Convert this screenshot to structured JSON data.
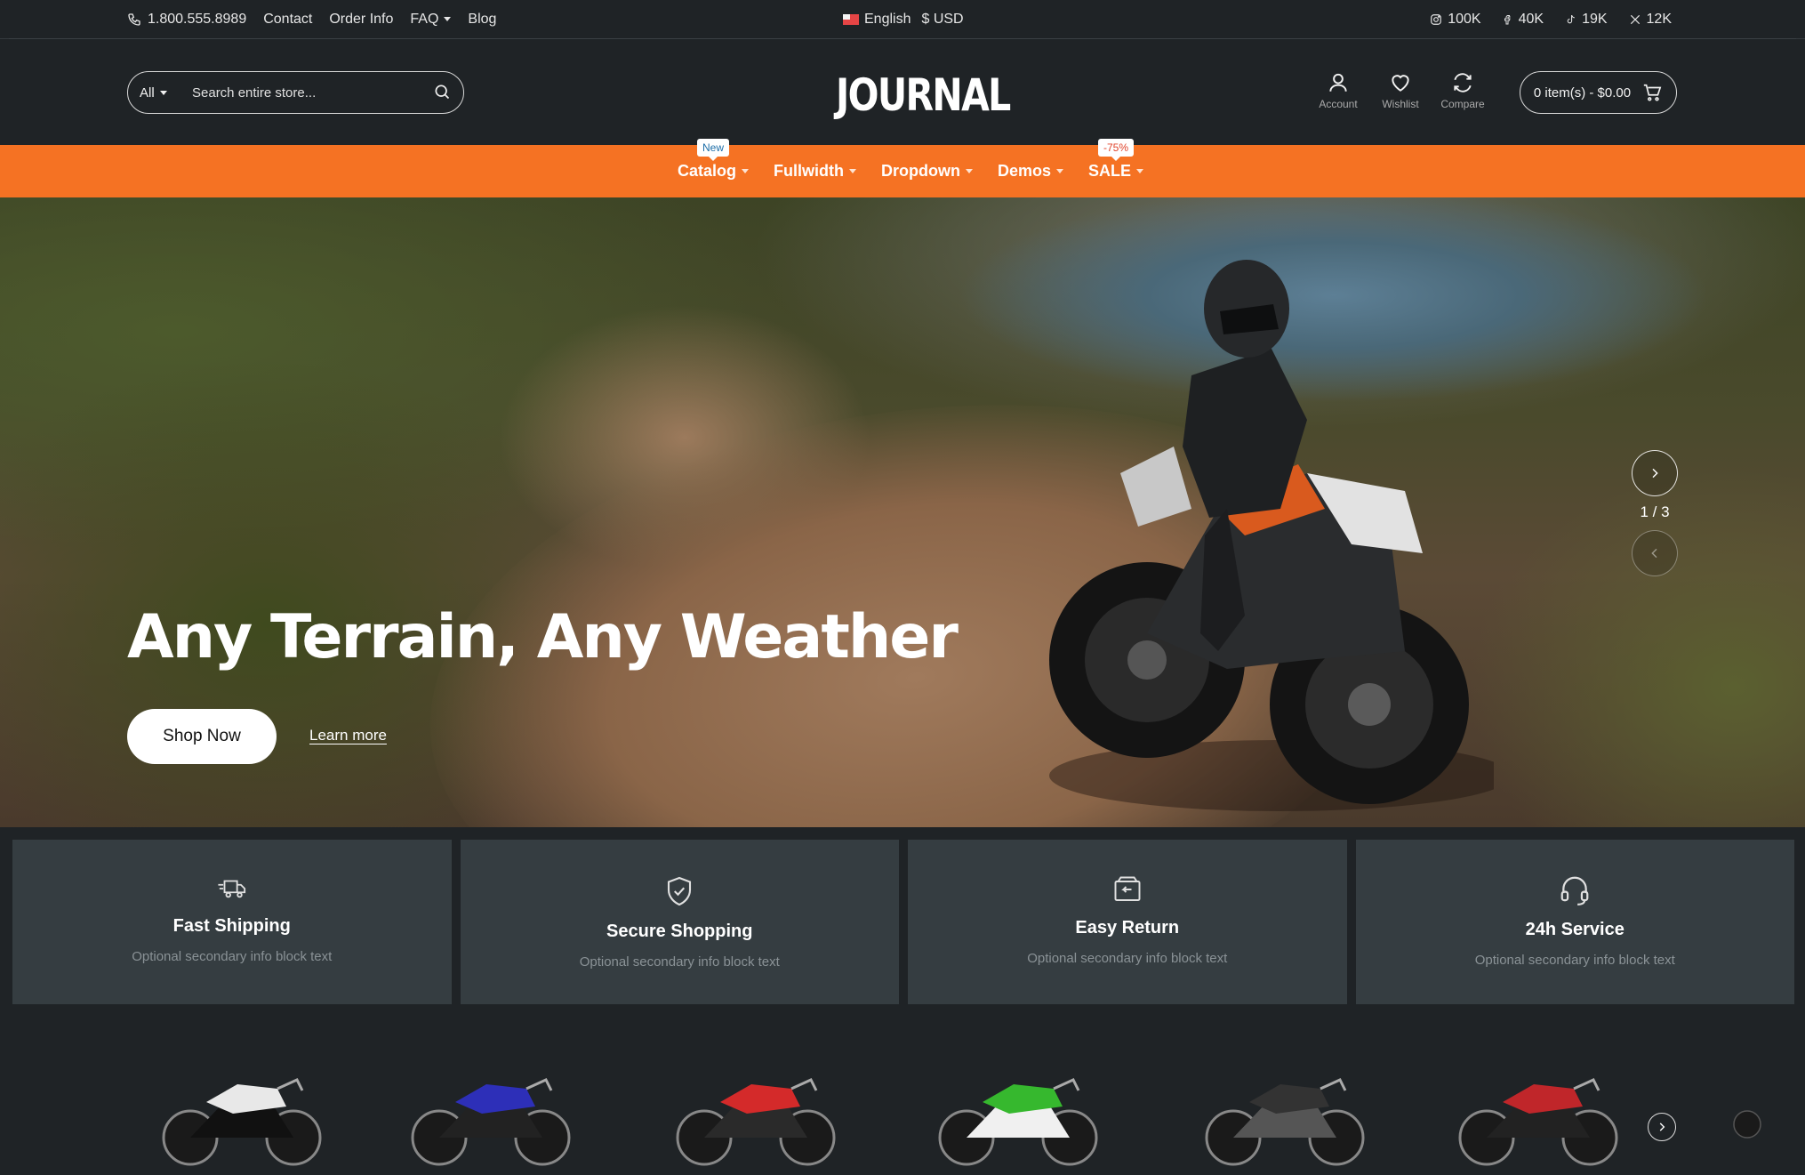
{
  "topbar": {
    "phone": "1.800.555.8989",
    "links": [
      "Contact",
      "Order Info",
      "FAQ",
      "Blog"
    ],
    "language": "English",
    "currency": "$ USD",
    "social": [
      {
        "icon": "instagram-icon",
        "count": "100K"
      },
      {
        "icon": "facebook-icon",
        "count": "40K"
      },
      {
        "icon": "tiktok-icon",
        "count": "19K"
      },
      {
        "icon": "x-icon",
        "count": "12K"
      }
    ]
  },
  "header": {
    "search_category": "All",
    "search_placeholder": "Search entire store...",
    "logo": "JOURNAL",
    "account_label": "Account",
    "wishlist_label": "Wishlist",
    "compare_label": "Compare",
    "cart_label": "0 item(s) - $0.00"
  },
  "nav": {
    "items": [
      {
        "label": "Catalog",
        "badge": "New"
      },
      {
        "label": "Fullwidth",
        "badge": ""
      },
      {
        "label": "Dropdown",
        "badge": ""
      },
      {
        "label": "Demos",
        "badge": ""
      },
      {
        "label": "SALE",
        "badge": "-75%"
      }
    ]
  },
  "hero": {
    "title": "Any Terrain, Any Weather",
    "primary_button": "Shop Now",
    "secondary_link": "Learn more",
    "slide_counter": "1 / 3"
  },
  "features": [
    {
      "icon": "truck-icon",
      "title": "Fast Shipping",
      "subtitle": "Optional secondary info block text"
    },
    {
      "icon": "shield-check-icon",
      "title": "Secure Shopping",
      "subtitle": "Optional secondary info block text"
    },
    {
      "icon": "return-box-icon",
      "title": "Easy Return",
      "subtitle": "Optional secondary info block text"
    },
    {
      "icon": "headset-icon",
      "title": "24h Service",
      "subtitle": "Optional secondary info block text"
    }
  ],
  "colors": {
    "accent": "#f57223",
    "background": "#1f2326",
    "feature_bg": "#353d41"
  },
  "products": [
    {
      "color": "#e8e8e8",
      "accent": "#111111"
    },
    {
      "color": "#2d2fb8",
      "accent": "#222222"
    },
    {
      "color": "#d42a2a",
      "accent": "#2a2a2a"
    },
    {
      "color": "#36b82e",
      "accent": "#f0f0f0"
    },
    {
      "color": "#333333",
      "accent": "#555555"
    },
    {
      "color": "#c0262a",
      "accent": "#222222"
    }
  ]
}
